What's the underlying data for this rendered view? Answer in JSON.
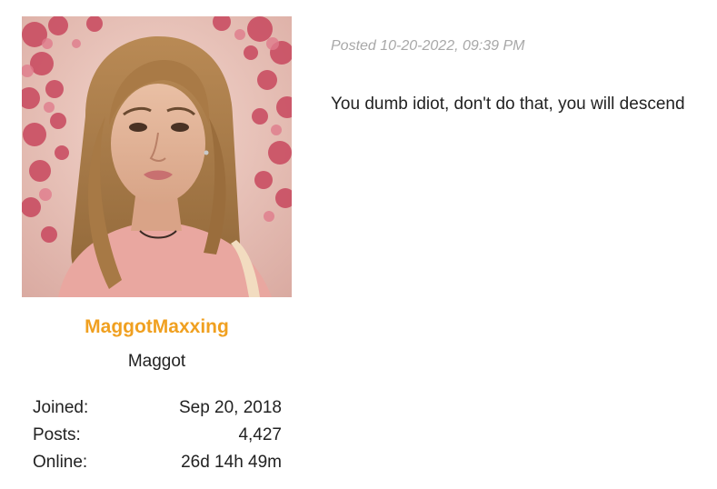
{
  "user": {
    "avatar": "avatar-photo",
    "username": "MaggotMaxxing",
    "username_color": "#f0a020",
    "title": "Maggot",
    "stats": [
      {
        "label": "Joined:",
        "value": "Sep 20, 2018"
      },
      {
        "label": "Posts:",
        "value": "4,427"
      },
      {
        "label": "Online:",
        "value": "26d 14h 49m"
      }
    ]
  },
  "post": {
    "date": "Posted 10-20-2022, 09:39 PM",
    "message": "You dumb idiot, don't do that, you will descend"
  }
}
